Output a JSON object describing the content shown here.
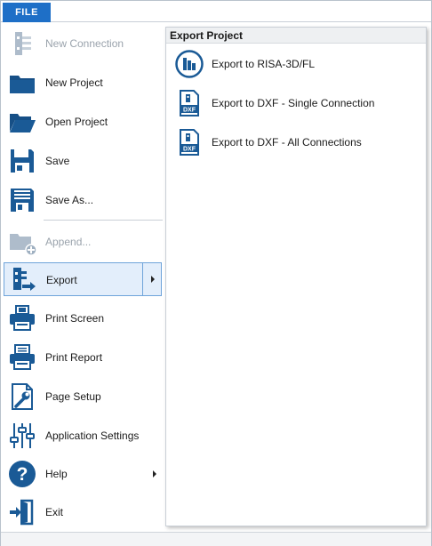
{
  "tabs": {
    "file_label": "FILE"
  },
  "menu": {
    "items": [
      {
        "label": "New Connection",
        "icon": "new-connection-icon",
        "disabled": true
      },
      {
        "label": "New Project",
        "icon": "folder-icon"
      },
      {
        "label": "Open Project",
        "icon": "open-folder-icon"
      },
      {
        "label": "Save",
        "icon": "floppy-disk-icon"
      },
      {
        "label": "Save As...",
        "icon": "save-as-icon"
      },
      {
        "label": "Append...",
        "icon": "append-folder-icon",
        "disabled": true
      },
      {
        "label": "Export",
        "icon": "export-icon",
        "selected": true,
        "has_submenu": true
      },
      {
        "label": "Print Screen",
        "icon": "printer-screen-icon"
      },
      {
        "label": "Print Report",
        "icon": "printer-report-icon"
      },
      {
        "label": "Page Setup",
        "icon": "wrench-page-icon"
      },
      {
        "label": "Application Settings",
        "icon": "sliders-icon"
      },
      {
        "label": "Help",
        "icon": "help-icon",
        "has_submenu": true
      },
      {
        "label": "Exit",
        "icon": "exit-door-icon"
      }
    ]
  },
  "submenu": {
    "title": "Export Project",
    "items": [
      {
        "label": "Export to RISA-3D/FL",
        "icon": "risa-bars-icon"
      },
      {
        "label": "Export to DXF - Single Connection",
        "icon": "dxf-file-icon"
      },
      {
        "label": "Export to DXF - All Connections",
        "icon": "dxf-file-icon"
      }
    ]
  },
  "colors": {
    "accent": "#1e6fc7",
    "icon_blue": "#1a5a96",
    "selection_bg": "#e3eefb",
    "selection_border": "#6fa4da",
    "disabled_text": "#9aa3ac"
  }
}
